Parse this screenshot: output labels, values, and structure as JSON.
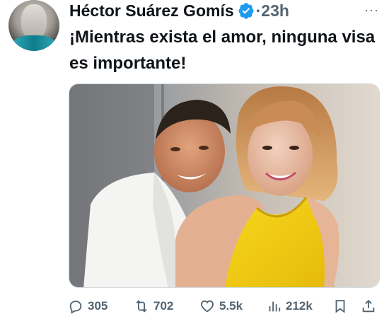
{
  "tweet": {
    "author_name": "Héctor Suárez Gomís",
    "time": "·23h",
    "more_icon": "more-horizontal-icon",
    "text": "¡Mientras exista el amor, ninguna visa es importante!",
    "image_icon": "photo-couple-hug"
  },
  "actions": {
    "replies": "305",
    "retweets": "702",
    "likes": "5.5k",
    "views": "212k"
  },
  "colors": {
    "verified_blue": "#1d9bf0",
    "text_gray": "#536471"
  }
}
